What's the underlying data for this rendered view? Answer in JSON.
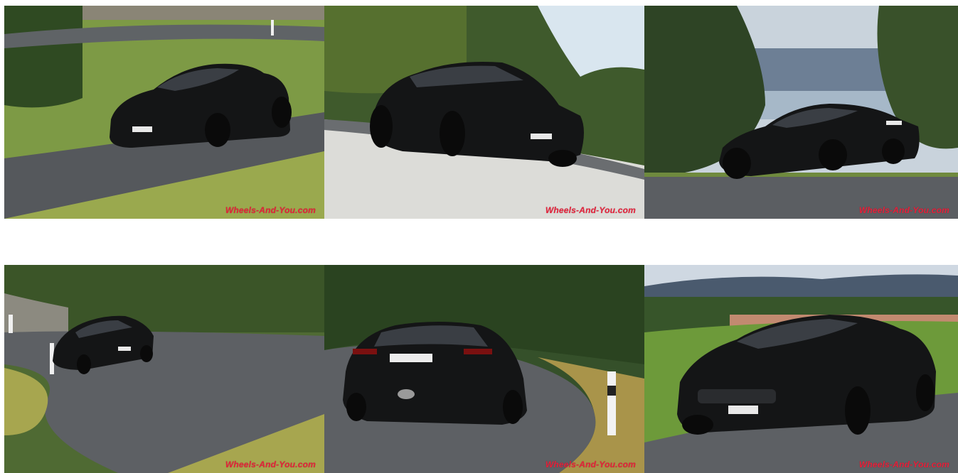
{
  "gallery": {
    "photos": [
      {
        "alt": "Black Jaguar F-Type coupe on a grassy mountain road",
        "watermark": "Wheels-And-You.com"
      },
      {
        "alt": "Black Jaguar F-Type coupe on a wet road, front three-quarter view",
        "watermark": "Wheels-And-You.com"
      },
      {
        "alt": "Black Jaguar F-Type coupe side view with lake in background",
        "watermark": "Wheels-And-You.com"
      },
      {
        "alt": "Black Jaguar F-Type coupe driving around a curve",
        "watermark": "Wheels-And-You.com"
      },
      {
        "alt": "Black Jaguar F-Type coupe rear view on a wet curve",
        "watermark": "Wheels-And-You.com"
      },
      {
        "alt": "Black Jaguar F-Type coupe front view with village in background",
        "watermark": "Wheels-And-You.com"
      }
    ],
    "colors": {
      "watermark": "#e8203a",
      "car": "#141516",
      "road": "#5d6064",
      "grass": "#7a9a3a"
    }
  }
}
